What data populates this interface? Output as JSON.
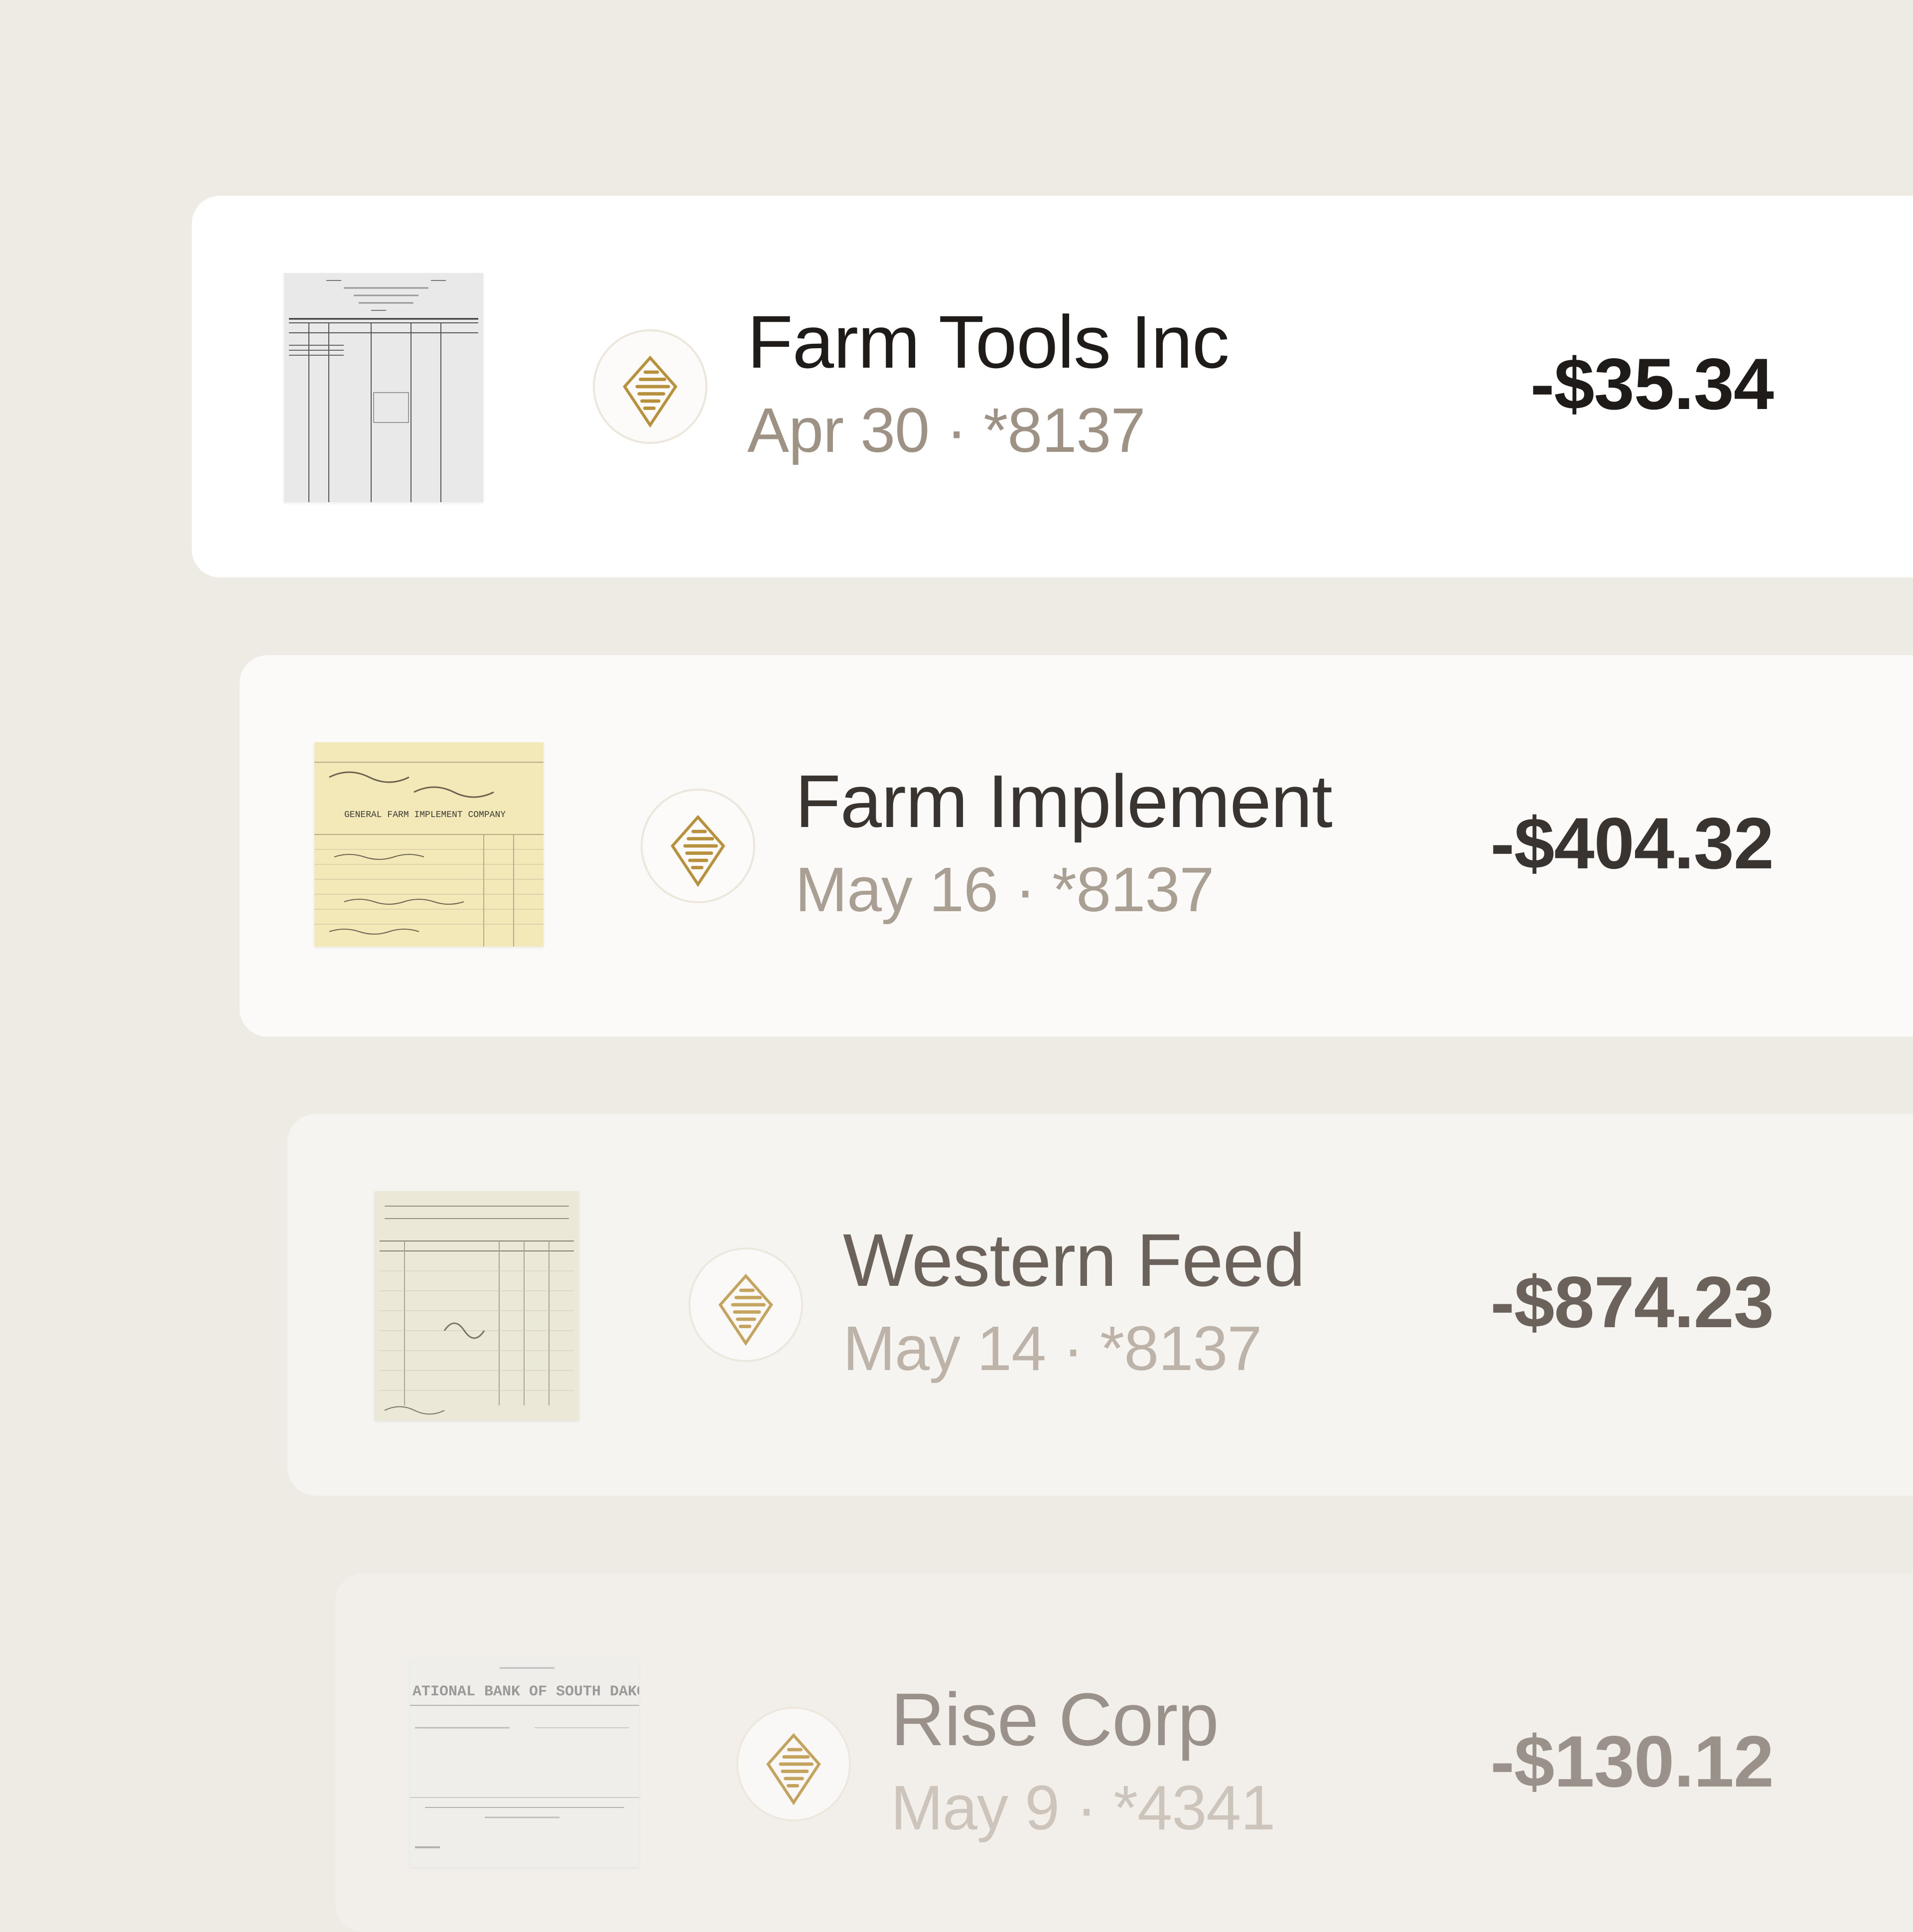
{
  "colors": {
    "background": "#eeeae4",
    "logo_gold": "#b8913c"
  },
  "transactions": [
    {
      "merchant": "Farm Tools Inc",
      "date": "Apr 30",
      "card": "*8137",
      "meta": "Apr 30 · *8137",
      "amount": "-$35.34",
      "icon": "merchant-logo-icon",
      "receipt": {
        "paper_color": "#e9e9e9"
      }
    },
    {
      "merchant": "Farm Implement",
      "date": "May 16",
      "card": "*8137",
      "meta": "May 16 · *8137",
      "amount": "-$404.32",
      "icon": "merchant-logo-icon",
      "receipt": {
        "paper_color": "#f3e8b8",
        "header_text": "GENERAL FARM IMPLEMENT COMPANY"
      }
    },
    {
      "merchant": "Western Feed",
      "date": "May 14",
      "card": "*8137",
      "meta": "May 14 · *8137",
      "amount": "-$874.23",
      "icon": "merchant-logo-icon",
      "receipt": {
        "paper_color": "#ece8d8"
      }
    },
    {
      "merchant": "Rise Corp",
      "date": "May 9",
      "card": "*4341",
      "meta": "May 9 · *4341",
      "amount": "-$130.12",
      "icon": "merchant-logo-icon",
      "receipt": {
        "paper_color": "#f0eeea",
        "header_text": "ATIONAL BANK OF SOUTH DAKOT"
      }
    }
  ]
}
